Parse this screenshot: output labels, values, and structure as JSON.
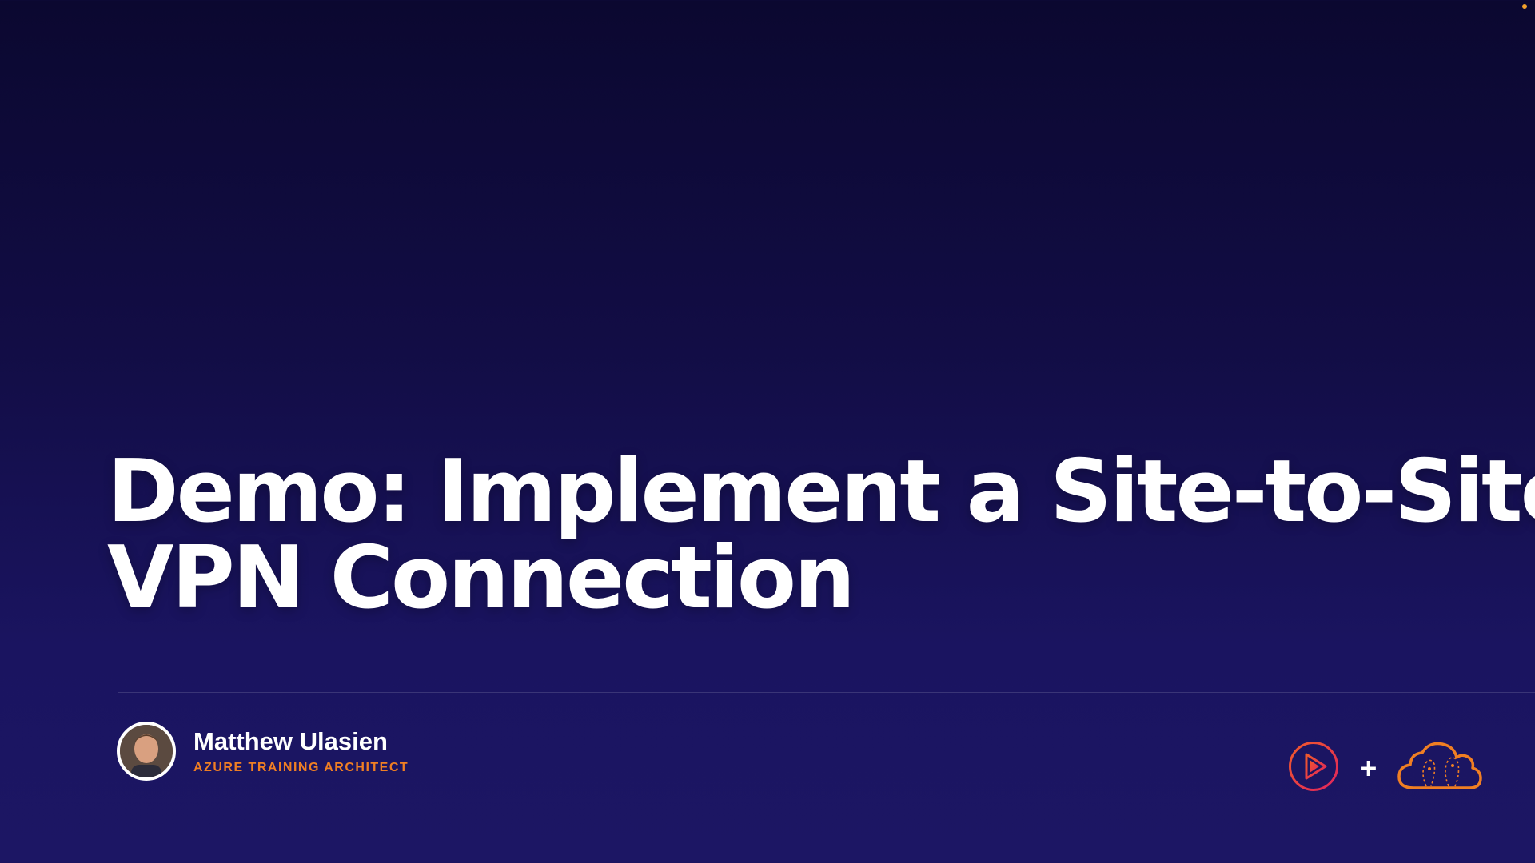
{
  "slide": {
    "title_line1": "Demo: Implement a Site-to-Site",
    "title_line2": "VPN Connection"
  },
  "presenter": {
    "name": "Matthew Ulasien",
    "role": "AZURE TRAINING ARCHITECT"
  },
  "logos": {
    "left_icon": "play-logo-icon",
    "joiner": "+",
    "right_icon": "cloud-logo-icon"
  },
  "colors": {
    "background_top": "#0b0830",
    "background_bottom": "#1c1664",
    "accent_orange": "#f07f23",
    "accent_pink": "#e0245e"
  }
}
